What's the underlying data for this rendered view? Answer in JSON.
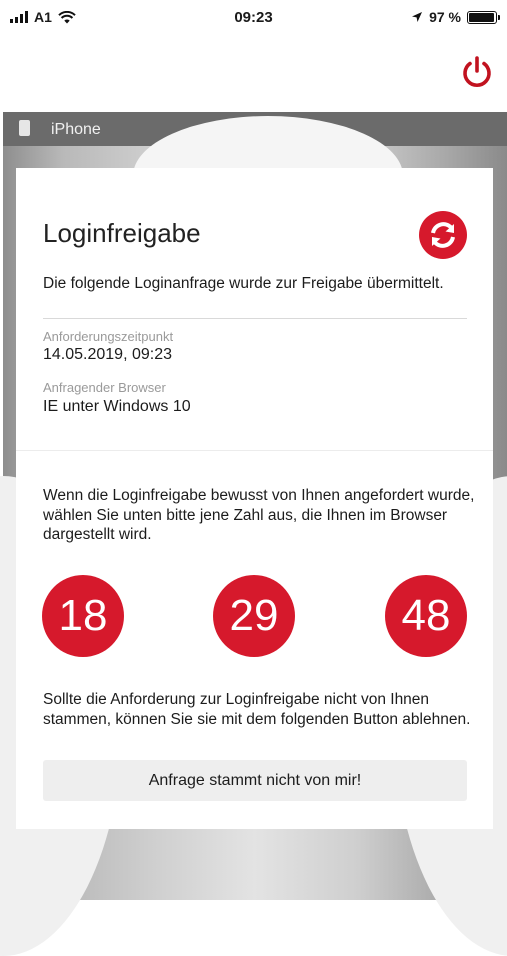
{
  "status_bar": {
    "carrier": "A1",
    "time": "09:23",
    "battery": "97 %",
    "battery_level": 0.97
  },
  "header": {
    "power_icon": "power-icon"
  },
  "device": {
    "icon": "phone-icon",
    "name": "iPhone"
  },
  "card": {
    "title": "Loginfreigabe",
    "refresh_icon": "refresh-icon",
    "intro": "Die folgende Loginanfrage wurde zur Freigabe übermittelt.",
    "request_time_label": "Anforderungszeitpunkt",
    "request_time_value": "14.05.2019, 09:23",
    "browser_label": "Anfragender Browser",
    "browser_value": "IE unter Windows 10",
    "instruction": "Wenn die Loginfreigabe bewusst von Ihnen angefordert wurde, wählen Sie unten bitte jene Zahl aus, die Ihnen im Browser dargestellt wird.",
    "numbers": [
      "18",
      "29",
      "48"
    ],
    "reject_text": "Sollte die Anforderung zur Loginfreigabe nicht von Ihnen stammen, können Sie sie mit dem folgenden Button ablehnen.",
    "reject_button": "Anfrage stammt nicht von mir!"
  },
  "colors": {
    "accent": "#d6192c",
    "device_bar": "#6b6b6b",
    "button_bg": "#eeeeee"
  }
}
